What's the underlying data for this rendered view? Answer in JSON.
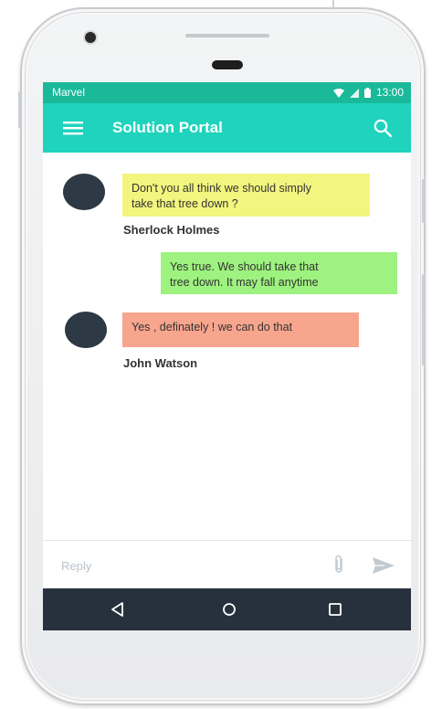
{
  "status_bar": {
    "carrier": "Marvel",
    "time": "13:00",
    "icons": [
      "wifi-icon",
      "signal-icon",
      "battery-icon"
    ]
  },
  "app_bar": {
    "title": "Solution Portal",
    "menu_icon": "menu-icon",
    "search_icon": "search-icon"
  },
  "messages": [
    {
      "text": "Don't you all think we should simply\ntake that tree down ?",
      "sender": "Sherlock Holmes",
      "side": "left",
      "color": "#f2f67e"
    },
    {
      "text": "Yes true. We should take that\ntree down. It may fall anytime",
      "sender": "",
      "side": "right",
      "color": "#9ef27f"
    },
    {
      "text": "Yes , definately ! we can do that",
      "sender": "John Watson",
      "side": "left",
      "color": "#f8a58e"
    }
  ],
  "composer": {
    "placeholder": "Reply",
    "value": "",
    "attach_icon": "paperclip-icon",
    "send_icon": "send-icon"
  },
  "nav_bar": {
    "icons": [
      "back-icon",
      "home-icon",
      "recents-icon"
    ]
  },
  "colors": {
    "status_bar": "#19b99a",
    "app_bar": "#1fd3bd",
    "avatar": "#2d3944",
    "nav_bar": "#27313d"
  }
}
